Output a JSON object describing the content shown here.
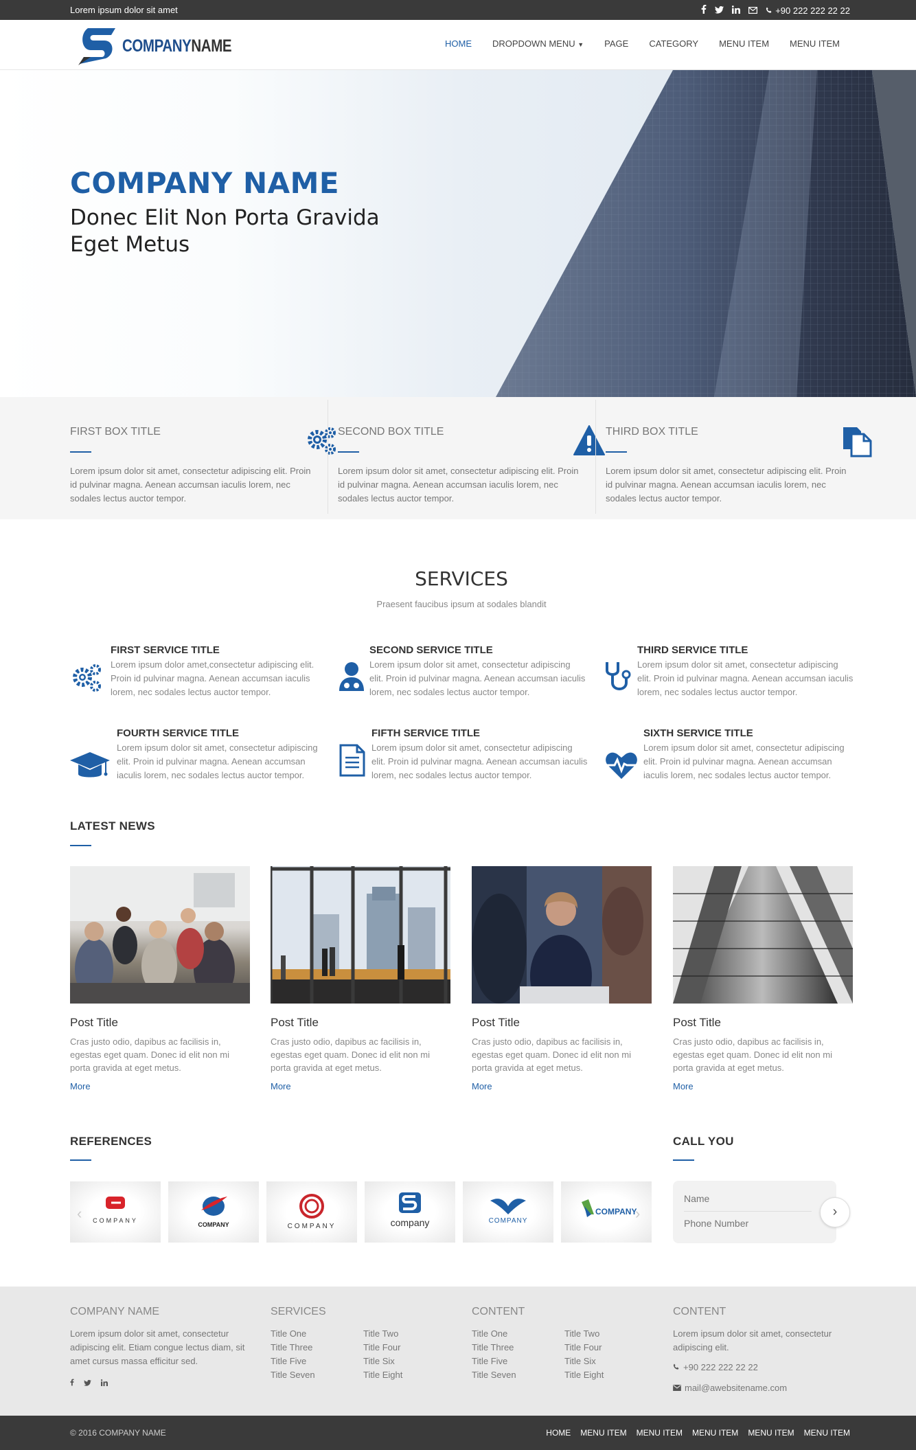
{
  "topbar": {
    "tagline": "Lorem ipsum dolor sit amet",
    "phone": "+90 222 222 22 22",
    "social": [
      "facebook-icon",
      "twitter-icon",
      "linkedin-icon",
      "mail-icon"
    ]
  },
  "header": {
    "logo_company": "COMPANY",
    "logo_name": "NAME",
    "nav": [
      {
        "label": "HOME",
        "active": true
      },
      {
        "label": "DROPDOWN MENU"
      },
      {
        "label": "PAGE"
      },
      {
        "label": "CATEGORY"
      },
      {
        "label": "MENU ITEM"
      },
      {
        "label": "MENU ITEM"
      }
    ]
  },
  "hero": {
    "title": "COMPANY NAME",
    "subtitle": "Donec Elit Non Porta Gravida Eget Metus"
  },
  "boxes": [
    {
      "title": "FIRST BOX TITLE",
      "text": "Lorem ipsum dolor sit amet, consectetur adipiscing elit. Proin id pulvinar magna. Aenean accumsan iaculis lorem, nec sodales lectus auctor tempor.",
      "icon": "gears-icon"
    },
    {
      "title": "SECOND BOX TITLE",
      "text": "Lorem ipsum dolor sit amet, consectetur adipiscing elit. Proin id pulvinar magna. Aenean accumsan iaculis lorem, nec sodales lectus auctor tempor.",
      "icon": "warning-icon"
    },
    {
      "title": "THIRD BOX TITLE",
      "text": "Lorem ipsum dolor sit amet, consectetur adipiscing elit. Proin id pulvinar magna. Aenean accumsan iaculis lorem, nec sodales lectus auctor tempor.",
      "icon": "documents-icon"
    }
  ],
  "services": {
    "title": "SERVICES",
    "subtitle": "Praesent faucibus ipsum at sodales blandit",
    "items": [
      {
        "title": "FIRST SERVICE TITLE",
        "text": "Lorem ipsum dolor amet,consectetur adipiscing elit. Proin id pulvinar magna. Aenean accumsan iaculis lorem, nec sodales lectus auctor tempor.",
        "icon": "gears-icon"
      },
      {
        "title": "SECOND SERVICE TITLE",
        "text": "Lorem ipsum dolor sit amet, consectetur adipiscing elit. Proin id pulvinar magna. Aenean accumsan iaculis lorem, nec sodales lectus auctor tempor.",
        "icon": "doctor-icon"
      },
      {
        "title": "THIRD SERVICE TITLE",
        "text": "Lorem ipsum dolor sit amet, consectetur adipiscing elit. Proin id pulvinar magna. Aenean accumsan iaculis lorem, nec sodales lectus auctor tempor.",
        "icon": "stethoscope-icon"
      },
      {
        "title": "FOURTH SERVICE TITLE",
        "text": "Lorem ipsum dolor sit amet, consectetur adipiscing elit. Proin id pulvinar magna. Aenean accumsan iaculis lorem, nec sodales lectus auctor tempor.",
        "icon": "graduation-cap-icon"
      },
      {
        "title": "FIFTH SERVICE TITLE",
        "text": "Lorem ipsum dolor sit amet, consectetur adipiscing elit. Proin id pulvinar magna. Aenean accumsan iaculis lorem, nec sodales lectus auctor tempor.",
        "icon": "document-icon"
      },
      {
        "title": "SIXTH SERVICE TITLE",
        "text": "Lorem ipsum dolor sit amet, consectetur adipiscing elit. Proin id pulvinar magna. Aenean accumsan iaculis lorem, nec sodales lectus auctor tempor.",
        "icon": "heartbeat-icon"
      }
    ]
  },
  "news": {
    "title": "LATEST NEWS",
    "posts": [
      {
        "title": "Post Title",
        "text": "Cras justo odio, dapibus ac facilisis in, egestas eget quam. Donec id elit non mi porta gravida at eget metus.",
        "more": "More"
      },
      {
        "title": "Post Title",
        "text": "Cras justo odio, dapibus ac facilisis in, egestas eget quam. Donec id elit non mi porta gravida at eget metus.",
        "more": "More"
      },
      {
        "title": "Post Title",
        "text": "Cras justo odio, dapibus ac facilisis in, egestas eget quam. Donec id elit non mi porta gravida at eget metus.",
        "more": "More"
      },
      {
        "title": "Post Title",
        "text": "Cras justo odio, dapibus ac facilisis in, egestas eget quam. Donec id elit non mi porta gravida at eget metus.",
        "more": "More"
      }
    ]
  },
  "references": {
    "title": "REFERENCES",
    "logos": [
      "COMPANY",
      "COMPANY",
      "COMPANY",
      "company",
      "COMPANY",
      "COMPANY"
    ]
  },
  "call": {
    "title": "CALL YOU",
    "name_placeholder": "Name",
    "phone_placeholder": "Phone Number"
  },
  "footer": {
    "about_title": "COMPANY NAME",
    "about_text": "Lorem ipsum dolor sit amet, consectetur adipiscing elit. Etiam congue lectus diam, sit amet cursus massa efficitur sed.",
    "services_title": "SERVICES",
    "services_col1": [
      "Title One",
      "Title Three",
      "Title Five",
      "Title Seven"
    ],
    "services_col2": [
      "Title Two",
      "Title Four",
      "Title Six",
      "Title Eight"
    ],
    "content_title": "CONTENT",
    "content_col1": [
      "Title One",
      "Title Three",
      "Title Five",
      "Title Seven"
    ],
    "content_col2": [
      "Title Two",
      "Title Four",
      "Title Six",
      "Title Eight"
    ],
    "contact_title": "CONTENT",
    "contact_text": "Lorem ipsum dolor sit amet, consectetur adipiscing elit.",
    "phone": "+90 222 222 22 22",
    "email": "mail@awebsitename.com"
  },
  "bottom": {
    "copyright": "© 2016 COMPANY NAME",
    "nav": [
      "HOME",
      "MENU ITEM",
      "MENU ITEM",
      "MENU ITEM",
      "MENU ITEM",
      "MENU ITEM"
    ]
  },
  "colors": {
    "accent": "#1f5fa6",
    "dark": "#3a3a3a",
    "light": "#f5f5f5"
  }
}
